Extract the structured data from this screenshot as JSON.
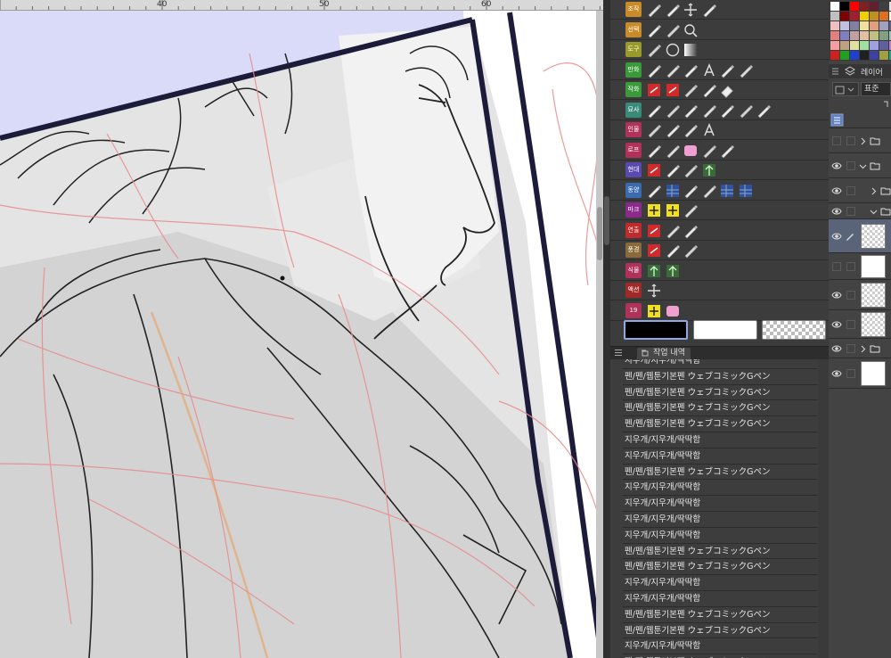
{
  "canvas": {
    "ruler_labels": [
      "40",
      "50",
      "60"
    ],
    "background_color": "#d9dbf9"
  },
  "tool_palette": {
    "categories": [
      {
        "label": "조작",
        "color": "#c98b2a",
        "tools": [
          "object-select-icon",
          "layer-select-icon",
          "move-icon",
          "rotate-icon"
        ]
      },
      {
        "label": "선택",
        "color": "#c98b2a",
        "tools": [
          "lasso-icon",
          "magic-wand-icon",
          "zoom-icon"
        ]
      },
      {
        "label": "도구",
        "color": "#9a9a2a",
        "tools": [
          "ruler-icon",
          "ellipse-icon",
          "gradient-icon"
        ]
      },
      {
        "label": "만화",
        "color": "#3a9a3a",
        "tools": [
          "speed-line-icon",
          "frame-border-icon",
          "layer-stack-icon",
          "text-icon",
          "pen-tool-icon",
          "balloon-icon"
        ]
      },
      {
        "label": "작화",
        "color": "#3a9a3a",
        "tools": [
          "red-brush-icon",
          "fill-icon",
          "stamp-icon",
          "pencil-icon",
          "eraser-icon"
        ]
      },
      {
        "label": "묘사",
        "color": "#3a8a7a",
        "tools": [
          "pen-pressure-icon",
          "g-pen-icon",
          "marker-icon",
          "ink-pen-icon",
          "airbrush-icon",
          "blend-icon",
          "water-drop-icon"
        ]
      },
      {
        "label": "인물",
        "color": "#b0325a",
        "tools": [
          "pencil-sketch-icon",
          "hair-icon",
          "pen-fine-icon",
          "texture-icon"
        ]
      },
      {
        "label": "로프",
        "color": "#b0325a",
        "tools": [
          "chain-icon",
          "ribbon-icon",
          "cup-icon",
          "copy-icon",
          "bow-icon"
        ]
      },
      {
        "label": "현대",
        "color": "#5a4ab0",
        "tools": [
          "grid-red-icon",
          "shine-icon",
          "lines-icon",
          "tree-icon"
        ]
      },
      {
        "label": "동양",
        "color": "#3a6ab0",
        "tools": [
          "bowtie-icon",
          "western-icon",
          "blossom-icon",
          "ornament-icon",
          "sf-icon",
          "city-icon"
        ]
      },
      {
        "label": "마크",
        "color": "#8a2a8a",
        "tools": [
          "star-mark-icon",
          "win-icon",
          "chain-mark-icon"
        ]
      },
      {
        "label": "연출",
        "color": "#c02a2a",
        "tools": [
          "red-burst-icon",
          "sparkle-lines-icon",
          "flash-icon"
        ]
      },
      {
        "label": "풍경",
        "color": "#8a6a3a",
        "tools": [
          "star-burst-icon",
          "brush-stroke-icon",
          "quill-icon"
        ]
      },
      {
        "label": "식물",
        "color": "#b0325a",
        "tools": [
          "flower-icon",
          "grass-icon"
        ]
      },
      {
        "label": "액션",
        "color": "#a02a2a",
        "tools": [
          "cross-arrows-icon"
        ]
      },
      {
        "label": "19",
        "color": "#b0325a",
        "tools": [
          "yellow-plus-icon",
          "pink-pattern-icon"
        ]
      }
    ],
    "colors": {
      "main": "#000000",
      "sub": "#ffffff",
      "transparent": "transparent"
    }
  },
  "history": {
    "tab_label": "작업 내역",
    "items": [
      "지우개/지우개/딱딱함",
      "펜/펜/웹툰기본펜 ウェブコミックGペン",
      "펜/펜/웹툰기본펜 ウェブコミックGペン",
      "펜/펜/웹툰기본펜 ウェブコミックGペン",
      "펜/펜/웹툰기본펜 ウェブコミックGペン",
      "지우개/지우개/딱딱함",
      "지우개/지우개/딱딱함",
      "펜/펜/웹툰기본펜 ウェブコミックGペン",
      "지우개/지우개/딱딱함",
      "지우개/지우개/딱딱함",
      "지우개/지우개/딱딱함",
      "지우개/지우개/딱딱함",
      "펜/펜/웹툰기본펜 ウェブコミックGペン",
      "펜/펜/웹툰기본펜 ウェブコミックGペン",
      "지우개/지우개/딱딱함",
      "지우개/지우개/딱딱함",
      "펜/펜/웹툰기본펜 ウェブコミックGペン",
      "펜/펜/웹툰기본펜 ウェブコミックGペン",
      "지우개/지우개/딱딱함",
      "펜/펜/웹툰기본펜 ウェブコミックGペン"
    ]
  },
  "layers": {
    "tab_label": "레이어",
    "blend_mode": "표준"
  }
}
